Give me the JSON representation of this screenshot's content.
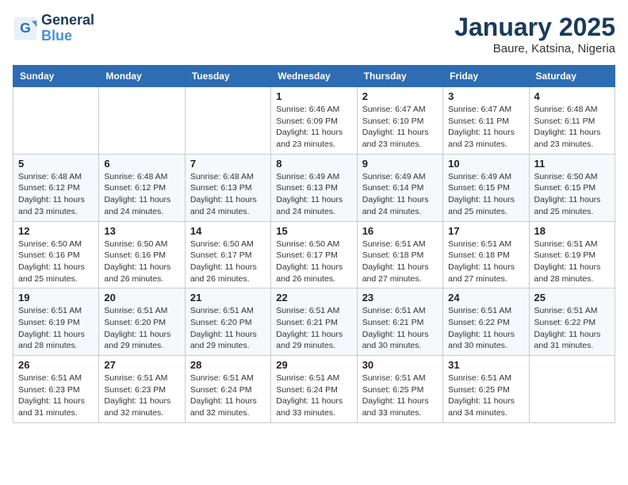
{
  "logo": {
    "line1": "General",
    "line2": "Blue"
  },
  "title": "January 2025",
  "subtitle": "Baure, Katsina, Nigeria",
  "days_header": [
    "Sunday",
    "Monday",
    "Tuesday",
    "Wednesday",
    "Thursday",
    "Friday",
    "Saturday"
  ],
  "weeks": [
    [
      {
        "num": "",
        "info": ""
      },
      {
        "num": "",
        "info": ""
      },
      {
        "num": "",
        "info": ""
      },
      {
        "num": "1",
        "info": "Sunrise: 6:46 AM\nSunset: 6:09 PM\nDaylight: 11 hours\nand 23 minutes."
      },
      {
        "num": "2",
        "info": "Sunrise: 6:47 AM\nSunset: 6:10 PM\nDaylight: 11 hours\nand 23 minutes."
      },
      {
        "num": "3",
        "info": "Sunrise: 6:47 AM\nSunset: 6:11 PM\nDaylight: 11 hours\nand 23 minutes."
      },
      {
        "num": "4",
        "info": "Sunrise: 6:48 AM\nSunset: 6:11 PM\nDaylight: 11 hours\nand 23 minutes."
      }
    ],
    [
      {
        "num": "5",
        "info": "Sunrise: 6:48 AM\nSunset: 6:12 PM\nDaylight: 11 hours\nand 23 minutes."
      },
      {
        "num": "6",
        "info": "Sunrise: 6:48 AM\nSunset: 6:12 PM\nDaylight: 11 hours\nand 24 minutes."
      },
      {
        "num": "7",
        "info": "Sunrise: 6:48 AM\nSunset: 6:13 PM\nDaylight: 11 hours\nand 24 minutes."
      },
      {
        "num": "8",
        "info": "Sunrise: 6:49 AM\nSunset: 6:13 PM\nDaylight: 11 hours\nand 24 minutes."
      },
      {
        "num": "9",
        "info": "Sunrise: 6:49 AM\nSunset: 6:14 PM\nDaylight: 11 hours\nand 24 minutes."
      },
      {
        "num": "10",
        "info": "Sunrise: 6:49 AM\nSunset: 6:15 PM\nDaylight: 11 hours\nand 25 minutes."
      },
      {
        "num": "11",
        "info": "Sunrise: 6:50 AM\nSunset: 6:15 PM\nDaylight: 11 hours\nand 25 minutes."
      }
    ],
    [
      {
        "num": "12",
        "info": "Sunrise: 6:50 AM\nSunset: 6:16 PM\nDaylight: 11 hours\nand 25 minutes."
      },
      {
        "num": "13",
        "info": "Sunrise: 6:50 AM\nSunset: 6:16 PM\nDaylight: 11 hours\nand 26 minutes."
      },
      {
        "num": "14",
        "info": "Sunrise: 6:50 AM\nSunset: 6:17 PM\nDaylight: 11 hours\nand 26 minutes."
      },
      {
        "num": "15",
        "info": "Sunrise: 6:50 AM\nSunset: 6:17 PM\nDaylight: 11 hours\nand 26 minutes."
      },
      {
        "num": "16",
        "info": "Sunrise: 6:51 AM\nSunset: 6:18 PM\nDaylight: 11 hours\nand 27 minutes."
      },
      {
        "num": "17",
        "info": "Sunrise: 6:51 AM\nSunset: 6:18 PM\nDaylight: 11 hours\nand 27 minutes."
      },
      {
        "num": "18",
        "info": "Sunrise: 6:51 AM\nSunset: 6:19 PM\nDaylight: 11 hours\nand 28 minutes."
      }
    ],
    [
      {
        "num": "19",
        "info": "Sunrise: 6:51 AM\nSunset: 6:19 PM\nDaylight: 11 hours\nand 28 minutes."
      },
      {
        "num": "20",
        "info": "Sunrise: 6:51 AM\nSunset: 6:20 PM\nDaylight: 11 hours\nand 29 minutes."
      },
      {
        "num": "21",
        "info": "Sunrise: 6:51 AM\nSunset: 6:20 PM\nDaylight: 11 hours\nand 29 minutes."
      },
      {
        "num": "22",
        "info": "Sunrise: 6:51 AM\nSunset: 6:21 PM\nDaylight: 11 hours\nand 29 minutes."
      },
      {
        "num": "23",
        "info": "Sunrise: 6:51 AM\nSunset: 6:21 PM\nDaylight: 11 hours\nand 30 minutes."
      },
      {
        "num": "24",
        "info": "Sunrise: 6:51 AM\nSunset: 6:22 PM\nDaylight: 11 hours\nand 30 minutes."
      },
      {
        "num": "25",
        "info": "Sunrise: 6:51 AM\nSunset: 6:22 PM\nDaylight: 11 hours\nand 31 minutes."
      }
    ],
    [
      {
        "num": "26",
        "info": "Sunrise: 6:51 AM\nSunset: 6:23 PM\nDaylight: 11 hours\nand 31 minutes."
      },
      {
        "num": "27",
        "info": "Sunrise: 6:51 AM\nSunset: 6:23 PM\nDaylight: 11 hours\nand 32 minutes."
      },
      {
        "num": "28",
        "info": "Sunrise: 6:51 AM\nSunset: 6:24 PM\nDaylight: 11 hours\nand 32 minutes."
      },
      {
        "num": "29",
        "info": "Sunrise: 6:51 AM\nSunset: 6:24 PM\nDaylight: 11 hours\nand 33 minutes."
      },
      {
        "num": "30",
        "info": "Sunrise: 6:51 AM\nSunset: 6:25 PM\nDaylight: 11 hours\nand 33 minutes."
      },
      {
        "num": "31",
        "info": "Sunrise: 6:51 AM\nSunset: 6:25 PM\nDaylight: 11 hours\nand 34 minutes."
      },
      {
        "num": "",
        "info": ""
      }
    ]
  ]
}
